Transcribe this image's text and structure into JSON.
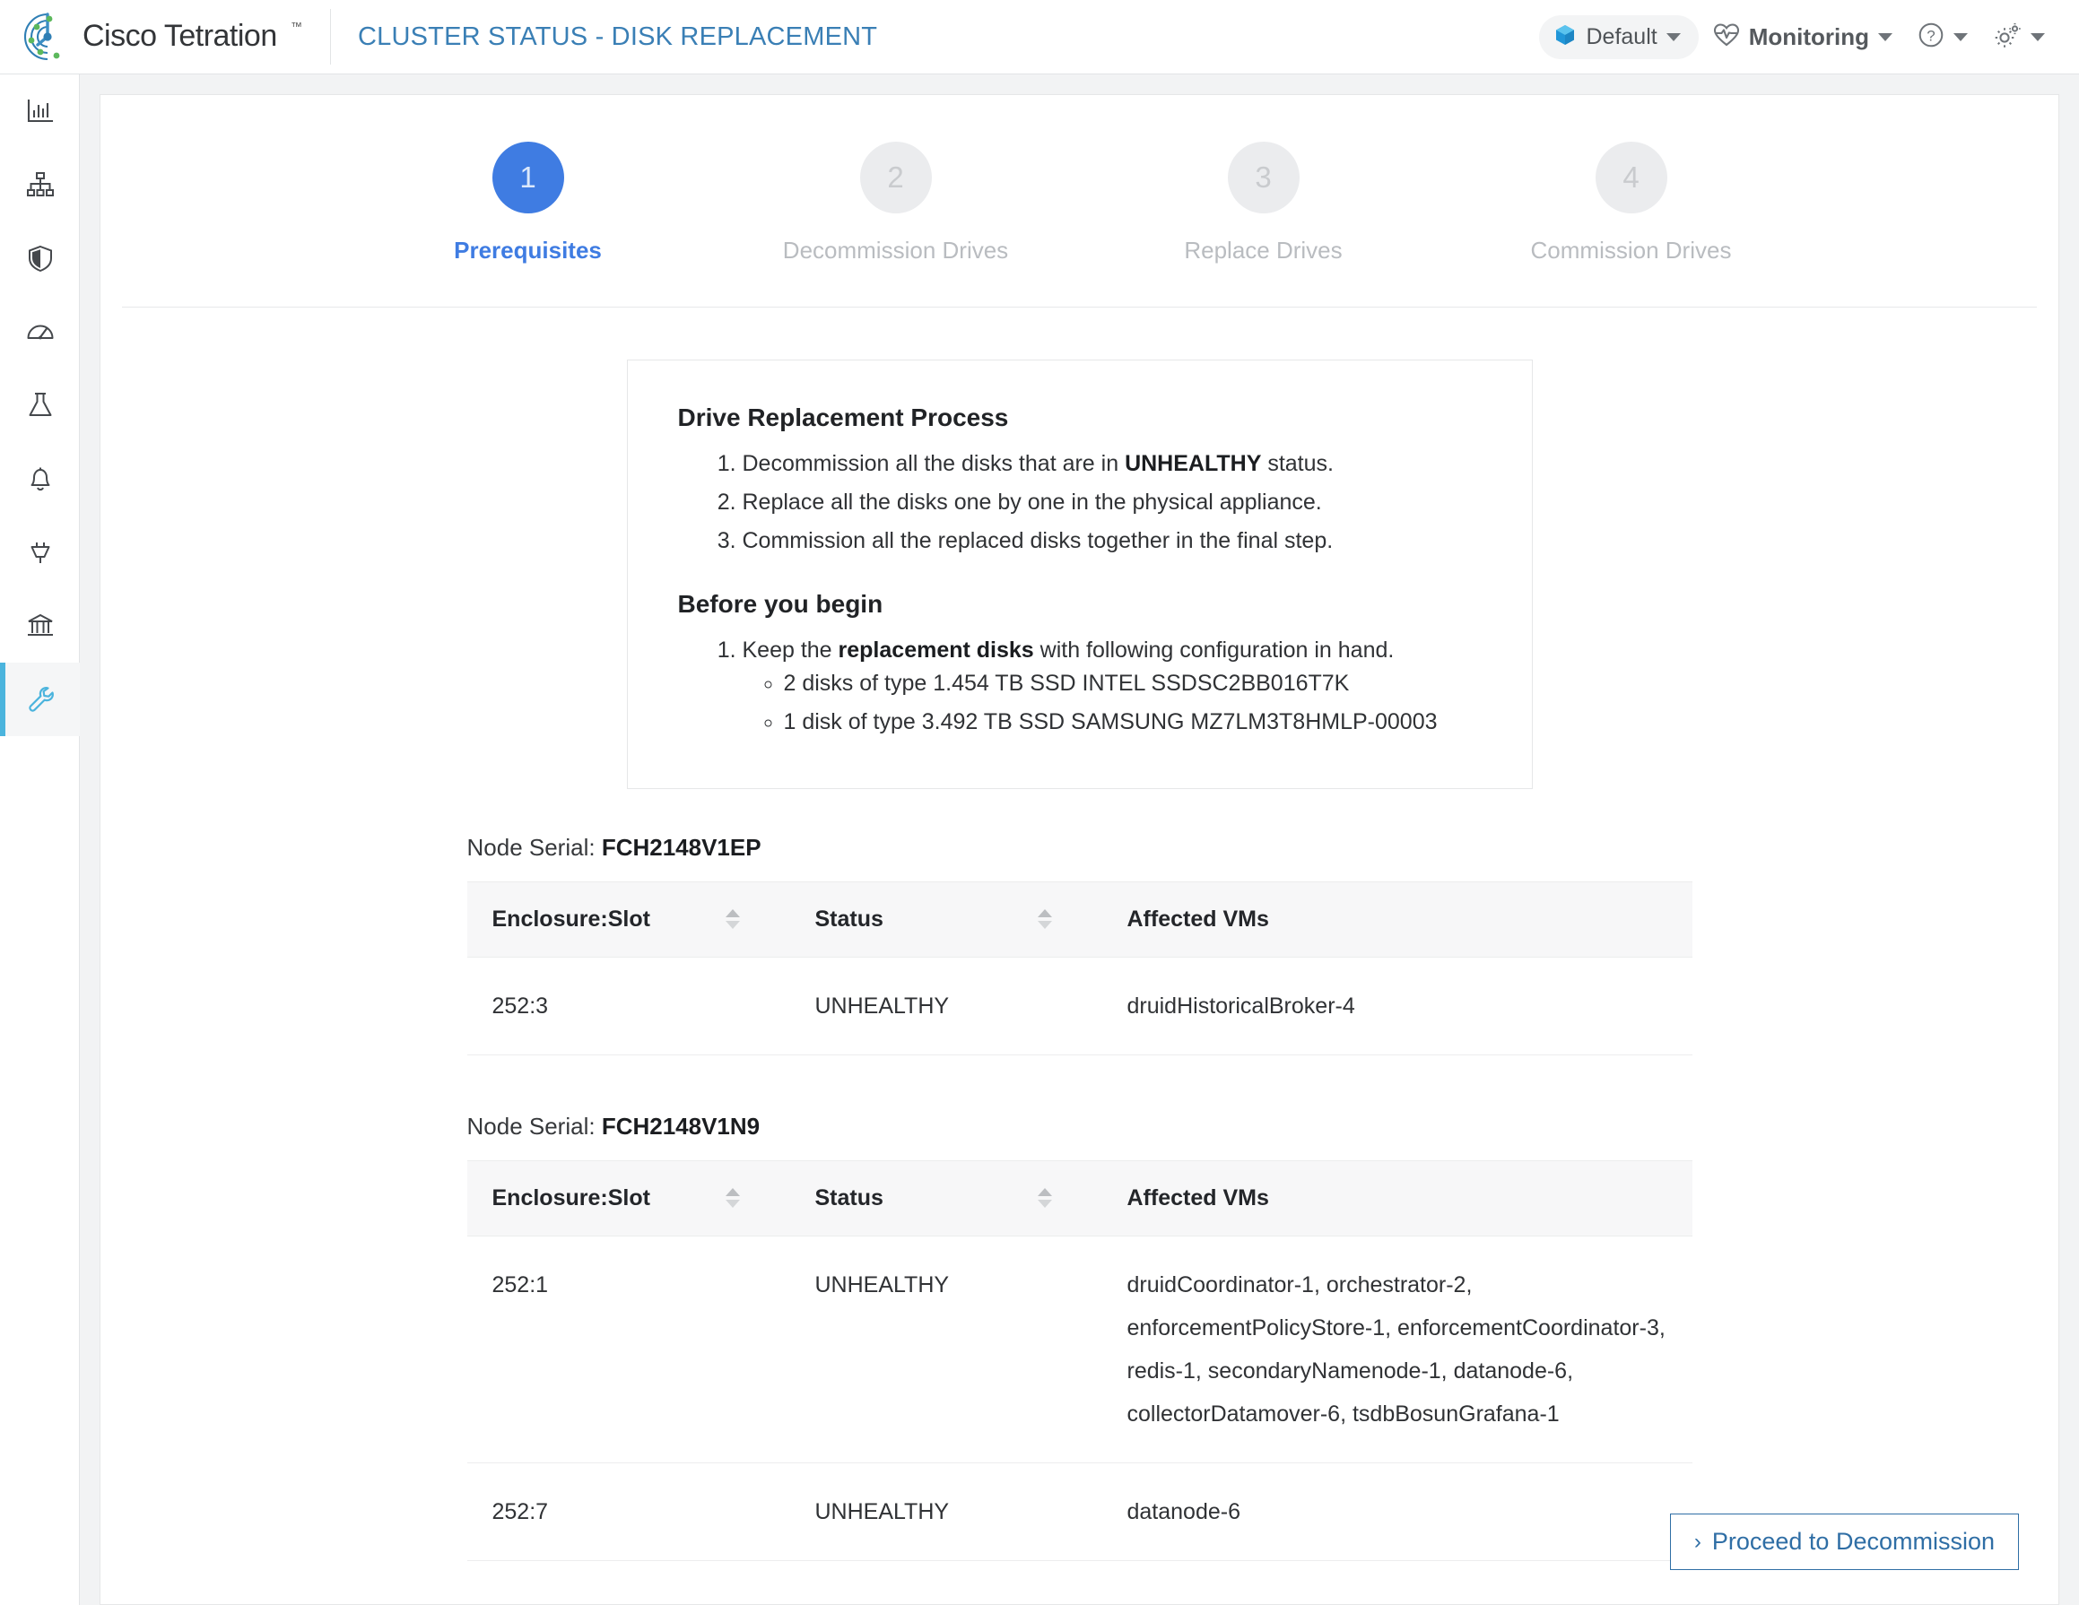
{
  "header": {
    "logo_name": "cisco-tetration-logo",
    "brand_text": "Cisco Tetration",
    "brand_tm": "™",
    "page_title": "CLUSTER STATUS - DISK REPLACEMENT",
    "scope": {
      "label": "Default",
      "icon": "cube-icon"
    },
    "monitoring": {
      "label": "Monitoring",
      "icon": "heartbeat-icon"
    },
    "help": {
      "icon": "question-circle-icon"
    },
    "settings": {
      "icon": "gear-icon"
    },
    "accent_blue": "#3a7fb5"
  },
  "sidebar": {
    "items": [
      {
        "icon": "bar-chart-icon",
        "active": false
      },
      {
        "icon": "org-chart-icon",
        "active": false
      },
      {
        "icon": "shield-icon",
        "active": false
      },
      {
        "icon": "gauge-icon",
        "active": false
      },
      {
        "icon": "flask-icon",
        "active": false
      },
      {
        "icon": "bell-icon",
        "active": false
      },
      {
        "icon": "plug-icon",
        "active": false
      },
      {
        "icon": "bank-icon",
        "active": false
      },
      {
        "icon": "wrench-icon",
        "active": true
      }
    ],
    "active_color": "#4bb4dd"
  },
  "stepper": {
    "active_color": "#3f7ce2",
    "steps": [
      {
        "number": "1",
        "label": "Prerequisites",
        "state": "active"
      },
      {
        "number": "2",
        "label": "Decommission Drives",
        "state": "idle"
      },
      {
        "number": "3",
        "label": "Replace Drives",
        "state": "idle"
      },
      {
        "number": "4",
        "label": "Commission Drives",
        "state": "idle"
      }
    ]
  },
  "info_card": {
    "process_heading": "Drive Replacement Process",
    "process_steps": [
      {
        "pre": "Decommission all the disks that are in ",
        "bold": "UNHEALTHY",
        "post": " status."
      },
      {
        "pre": "Replace all the disks one by one in the physical appliance.",
        "bold": "",
        "post": ""
      },
      {
        "pre": "Commission all the replaced disks together in the final step.",
        "bold": "",
        "post": ""
      }
    ],
    "begin_heading": "Before you begin",
    "begin_item": {
      "pre": "Keep the ",
      "bold": "replacement disks",
      "post": " with following configuration in hand."
    },
    "disk_requirements": [
      "2 disks of type 1.454 TB SSD INTEL SSDSC2BB016T7K",
      "1 disk of type 3.492 TB SSD SAMSUNG MZ7LM3T8HMLP-00003"
    ]
  },
  "tables": {
    "serial_prefix": "Node Serial: ",
    "columns": [
      "Enclosure:Slot",
      "Status",
      "Affected VMs"
    ],
    "nodes": [
      {
        "serial": "FCH2148V1EP",
        "rows": [
          {
            "slot": "252:3",
            "status": "UNHEALTHY",
            "vms": "druidHistoricalBroker-4"
          }
        ]
      },
      {
        "serial": "FCH2148V1N9",
        "rows": [
          {
            "slot": "252:1",
            "status": "UNHEALTHY",
            "vms": "druidCoordinator-1, orchestrator-2, enforcementPolicyStore-1, enforcementCoordinator-3, redis-1, secondaryNamenode-1, datanode-6, collectorDatamover-6, tsdbBosunGrafana-1"
          },
          {
            "slot": "252:7",
            "status": "UNHEALTHY",
            "vms": "datanode-6"
          }
        ]
      }
    ]
  },
  "footer": {
    "proceed_label": "Proceed to Decommission",
    "proceed_chevron": "›",
    "proceed_color": "#2f6ea5"
  }
}
